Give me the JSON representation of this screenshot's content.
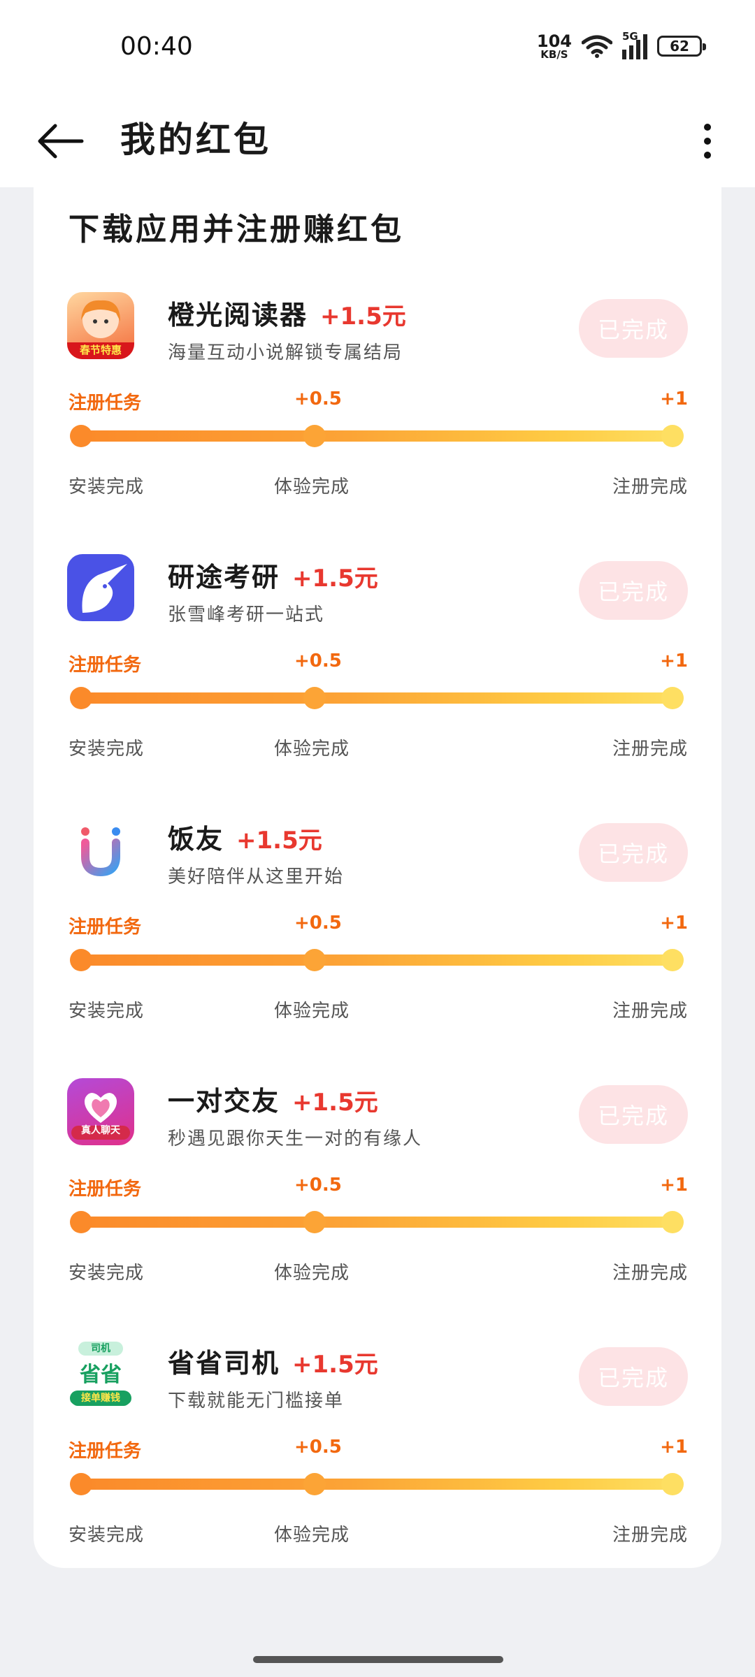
{
  "status_bar": {
    "time": "00:40",
    "net_speed_value": "104",
    "net_speed_unit": "KB/S",
    "network_type": "5G",
    "battery": "62"
  },
  "header": {
    "title": "我的红包"
  },
  "section": {
    "title": "下载应用并注册赚红包"
  },
  "tasks": [
    {
      "app_name": "橙光阅读器",
      "reward": "+1.5元",
      "description": "海量互动小说解锁专属结局",
      "button_label": "已完成",
      "icon_badge": "春节特惠",
      "milestones": {
        "start_label": "注册任务",
        "mid_value": "+0.5",
        "end_value": "+1",
        "step1": "安装完成",
        "step2": "体验完成",
        "step3": "注册完成"
      }
    },
    {
      "app_name": "研途考研",
      "reward": "+1.5元",
      "description": "张雪峰考研一站式",
      "button_label": "已完成",
      "icon_badge": "",
      "milestones": {
        "start_label": "注册任务",
        "mid_value": "+0.5",
        "end_value": "+1",
        "step1": "安装完成",
        "step2": "体验完成",
        "step3": "注册完成"
      }
    },
    {
      "app_name": "饭友",
      "reward": "+1.5元",
      "description": "美好陪伴从这里开始",
      "button_label": "已完成",
      "icon_badge": "",
      "milestones": {
        "start_label": "注册任务",
        "mid_value": "+0.5",
        "end_value": "+1",
        "step1": "安装完成",
        "step2": "体验完成",
        "step3": "注册完成"
      }
    },
    {
      "app_name": "一对交友",
      "reward": "+1.5元",
      "description": "秒遇见跟你天生一对的有缘人",
      "button_label": "已完成",
      "icon_badge": "真人聊天",
      "milestones": {
        "start_label": "注册任务",
        "mid_value": "+0.5",
        "end_value": "+1",
        "step1": "安装完成",
        "step2": "体验完成",
        "step3": "注册完成"
      }
    },
    {
      "app_name": "省省司机",
      "reward": "+1.5元",
      "description": "下载就能无门槛接单",
      "button_label": "已完成",
      "icon_badge_top": "司机",
      "icon_badge": "省省",
      "icon_badge_bottom": "接单赚钱",
      "milestones": {
        "start_label": "注册任务",
        "mid_value": "+0.5",
        "end_value": "+1",
        "step1": "安装完成",
        "step2": "体验完成",
        "step3": "注册完成"
      }
    }
  ],
  "colors": {
    "accent_orange": "#f2680f",
    "reward_red": "#e8382f",
    "done_button_bg": "#fde3e5",
    "progress_start": "#fb8a2a",
    "progress_end": "#fedf62"
  }
}
